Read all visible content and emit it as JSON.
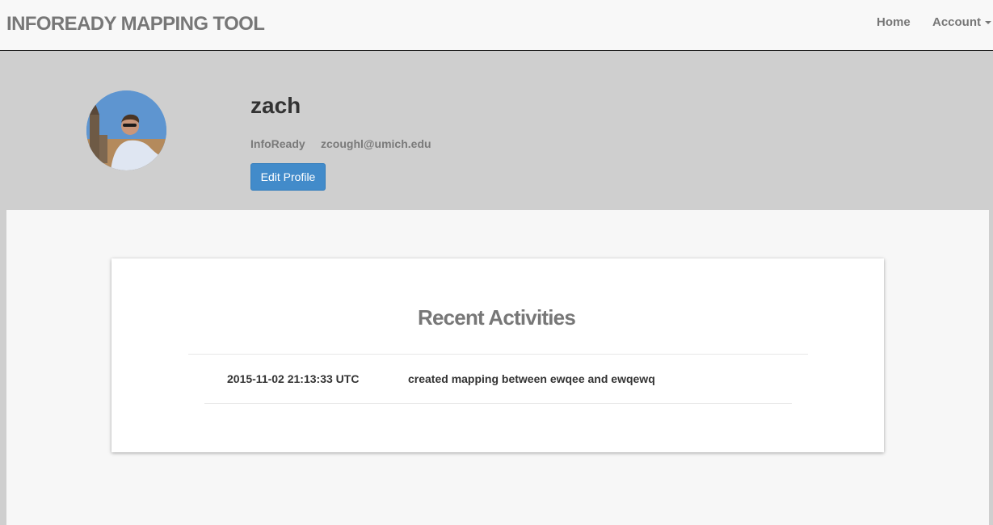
{
  "navbar": {
    "brand": "INFOREADY MAPPING TOOL",
    "home_label": "Home",
    "account_label": "Account"
  },
  "profile": {
    "username": "zach",
    "organization": "InfoReady",
    "email": "zcoughl@umich.edu",
    "edit_button_label": "Edit Profile"
  },
  "activities": {
    "title": "Recent Activities",
    "items": [
      {
        "timestamp": "2015-11-02 21:13:33 UTC",
        "description": "created mapping between ewqee and ewqewq"
      }
    ]
  },
  "colors": {
    "navbar_bg": "#f8f8f8",
    "header_bg": "#cfcfcf",
    "button_primary": "#428bca",
    "content_bg": "#f7f7f7"
  },
  "icons": {
    "account_caret": "chevron-down-icon"
  }
}
